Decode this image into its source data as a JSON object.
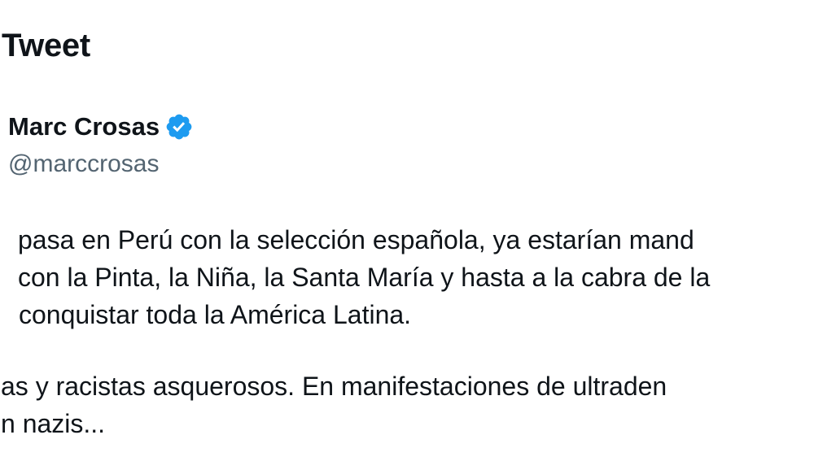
{
  "header": {
    "title": "Tweet"
  },
  "author": {
    "name": "Marc Crosas",
    "handle": "@marccrosas",
    "verified_icon": "verified-badge-icon",
    "badge_color": "#1d9bf0"
  },
  "tweet": {
    "paragraph1": [
      "pasa en Perú con la selección española, ya estarían mand",
      "con la Pinta, la Niña, la Santa María y hasta a la cabra de la",
      "conquistar toda la América Latina."
    ],
    "paragraph2": [
      "as y racistas asquerosos. En manifestaciones de ultraden",
      "n nazis..."
    ]
  },
  "colors": {
    "text": "#0f1419",
    "secondary_text": "#536471",
    "background": "#ffffff"
  }
}
